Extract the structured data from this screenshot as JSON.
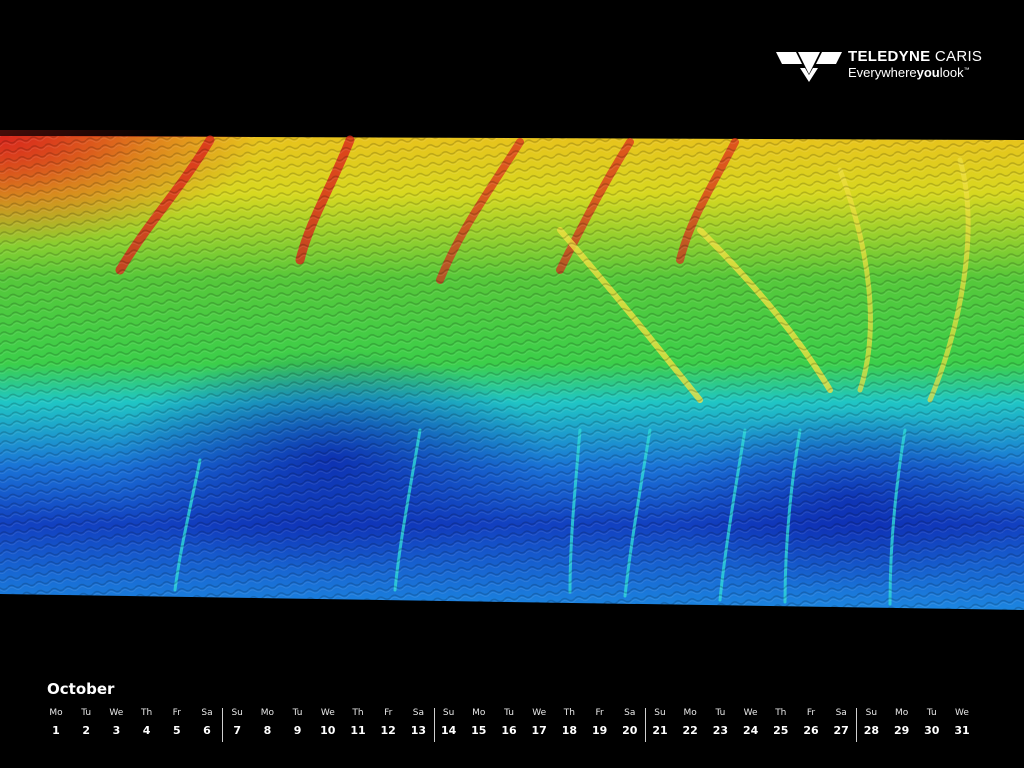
{
  "logo": {
    "brand_bold": "TELEDYNE",
    "brand_light": "CARIS",
    "tagline_pre": "Everywhere",
    "tagline_bold": "you",
    "tagline_post": "look",
    "trademark": "™"
  },
  "image": {
    "icon": "bathymetry-surface",
    "colors": [
      "#d8261c",
      "#f5a623",
      "#e8e020",
      "#3cc43a",
      "#1fc2c8",
      "#1565d8",
      "#0a1fa8"
    ]
  },
  "calendar": {
    "month": "October",
    "days": [
      {
        "dow": "Mo",
        "num": "1"
      },
      {
        "dow": "Tu",
        "num": "2"
      },
      {
        "dow": "We",
        "num": "3"
      },
      {
        "dow": "Th",
        "num": "4"
      },
      {
        "dow": "Fr",
        "num": "5"
      },
      {
        "dow": "Sa",
        "num": "6"
      },
      {
        "dow": "Su",
        "num": "7"
      },
      {
        "dow": "Mo",
        "num": "8"
      },
      {
        "dow": "Tu",
        "num": "9"
      },
      {
        "dow": "We",
        "num": "10"
      },
      {
        "dow": "Th",
        "num": "11"
      },
      {
        "dow": "Fr",
        "num": "12"
      },
      {
        "dow": "Sa",
        "num": "13"
      },
      {
        "dow": "Su",
        "num": "14"
      },
      {
        "dow": "Mo",
        "num": "15"
      },
      {
        "dow": "Tu",
        "num": "16"
      },
      {
        "dow": "We",
        "num": "17"
      },
      {
        "dow": "Th",
        "num": "18"
      },
      {
        "dow": "Fr",
        "num": "19"
      },
      {
        "dow": "Sa",
        "num": "20"
      },
      {
        "dow": "Su",
        "num": "21"
      },
      {
        "dow": "Mo",
        "num": "22"
      },
      {
        "dow": "Tu",
        "num": "23"
      },
      {
        "dow": "We",
        "num": "24"
      },
      {
        "dow": "Th",
        "num": "25"
      },
      {
        "dow": "Fr",
        "num": "26"
      },
      {
        "dow": "Sa",
        "num": "27"
      },
      {
        "dow": "Su",
        "num": "28"
      },
      {
        "dow": "Mo",
        "num": "29"
      },
      {
        "dow": "Tu",
        "num": "30"
      },
      {
        "dow": "We",
        "num": "31"
      }
    ]
  }
}
